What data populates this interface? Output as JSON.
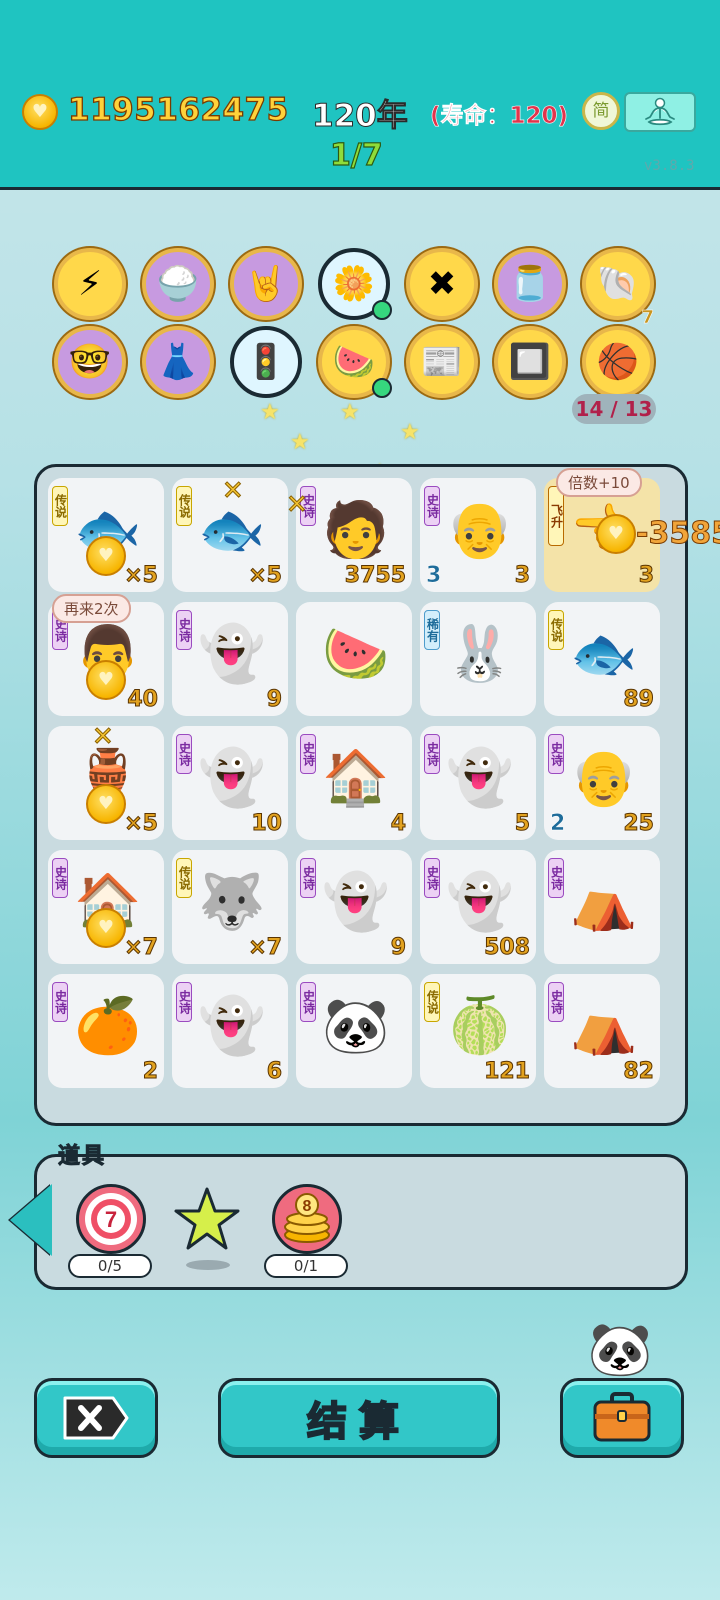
{
  "header": {
    "gold": "1195162475",
    "year": "120年",
    "lifespan": "(寿命：120)",
    "stage": "1/7",
    "lang_label": "简",
    "version": "v3.8.3"
  },
  "relics": {
    "count_label": "14 / 13",
    "shell_count": "7",
    "items": [
      {
        "name": "lightning",
        "icon": "⚡"
      },
      {
        "name": "rice-bowl",
        "icon": "🍚"
      },
      {
        "name": "rock-hand",
        "icon": "🤘"
      },
      {
        "name": "flower-pot",
        "icon": "🌼"
      },
      {
        "name": "delete-tag",
        "icon": "✖"
      },
      {
        "name": "jar",
        "icon": "🫙"
      },
      {
        "name": "shell",
        "icon": "🐚"
      },
      {
        "name": "doodle-face",
        "icon": "🤓"
      },
      {
        "name": "skirt",
        "icon": "👗"
      },
      {
        "name": "traffic-ghost",
        "icon": "🚦"
      },
      {
        "name": "fruit-plate",
        "icon": "🍉"
      },
      {
        "name": "time-magazine",
        "icon": "📰"
      },
      {
        "name": "chip",
        "icon": "🔲"
      },
      {
        "name": "basketballs",
        "icon": "🏀"
      }
    ]
  },
  "board": {
    "bubble_again": "再来2次",
    "bubble_multiplier": "倍数+10",
    "float_value": "-3585",
    "cells": [
      {
        "tag": "传说",
        "tagType": "legend",
        "icon": "🐟",
        "num": "×5",
        "coin": true
      },
      {
        "tag": "传说",
        "tagType": "legend",
        "icon": "🐟",
        "num": "×5"
      },
      {
        "tag": "史诗",
        "tagType": "epic",
        "icon": "🧑",
        "num": "3755"
      },
      {
        "tag": "史诗",
        "tagType": "epic",
        "icon": "👴",
        "num": "3",
        "left": "3"
      },
      {
        "tag": "飞升",
        "tagType": "fly",
        "icon": "👈",
        "num": "3",
        "highlight": true
      },
      {
        "tag": "史诗",
        "tagType": "epic",
        "icon": "👨",
        "num": "40",
        "coin": true
      },
      {
        "tag": "史诗",
        "tagType": "epic",
        "icon": "👻",
        "num": "9"
      },
      {
        "tag": "",
        "tagType": "",
        "icon": "🍉",
        "num": ""
      },
      {
        "tag": "稀有",
        "tagType": "rare",
        "icon": "🐰",
        "num": ""
      },
      {
        "tag": "传说",
        "tagType": "legend",
        "icon": "🐟",
        "num": "89"
      },
      {
        "tag": "",
        "tagType": "",
        "icon": "🏺",
        "num": "×5",
        "coin": true
      },
      {
        "tag": "史诗",
        "tagType": "epic",
        "icon": "👻",
        "num": "10"
      },
      {
        "tag": "史诗",
        "tagType": "epic",
        "icon": "🏠",
        "num": "4"
      },
      {
        "tag": "史诗",
        "tagType": "epic",
        "icon": "👻",
        "num": "5"
      },
      {
        "tag": "史诗",
        "tagType": "epic",
        "icon": "👴",
        "num": "25",
        "left": "2"
      },
      {
        "tag": "史诗",
        "tagType": "epic",
        "icon": "🏠",
        "num": "×7",
        "coin": true
      },
      {
        "tag": "传说",
        "tagType": "legend",
        "icon": "🐺",
        "num": "×7"
      },
      {
        "tag": "史诗",
        "tagType": "epic",
        "icon": "👻",
        "num": "9"
      },
      {
        "tag": "史诗",
        "tagType": "epic",
        "icon": "👻",
        "num": "508"
      },
      {
        "tag": "史诗",
        "tagType": "epic",
        "icon": "⛺",
        "num": ""
      },
      {
        "tag": "史诗",
        "tagType": "epic",
        "icon": "🍊",
        "num": "2"
      },
      {
        "tag": "史诗",
        "tagType": "epic",
        "icon": "👻",
        "num": "6"
      },
      {
        "tag": "史诗",
        "tagType": "epic",
        "icon": "🐼",
        "num": ""
      },
      {
        "tag": "传说",
        "tagType": "legend",
        "icon": "🍈",
        "num": "121"
      },
      {
        "tag": "史诗",
        "tagType": "epic",
        "icon": "⛺",
        "num": "82"
      }
    ]
  },
  "items": {
    "title": "道具",
    "dart": {
      "number": "7",
      "progress": "0/5"
    },
    "coins": {
      "number": "8",
      "progress": "0/1"
    }
  },
  "bottom": {
    "settle_label": "结算"
  },
  "colors": {
    "header": "#1fc4c1",
    "gold_text": "#ffd23a",
    "life_text": "#e2344c",
    "stage_text": "#8fdc3a",
    "epic_tag": "#ecd1f4",
    "legend_tag": "#fff6b8",
    "rare_tag": "#d3eefb"
  }
}
